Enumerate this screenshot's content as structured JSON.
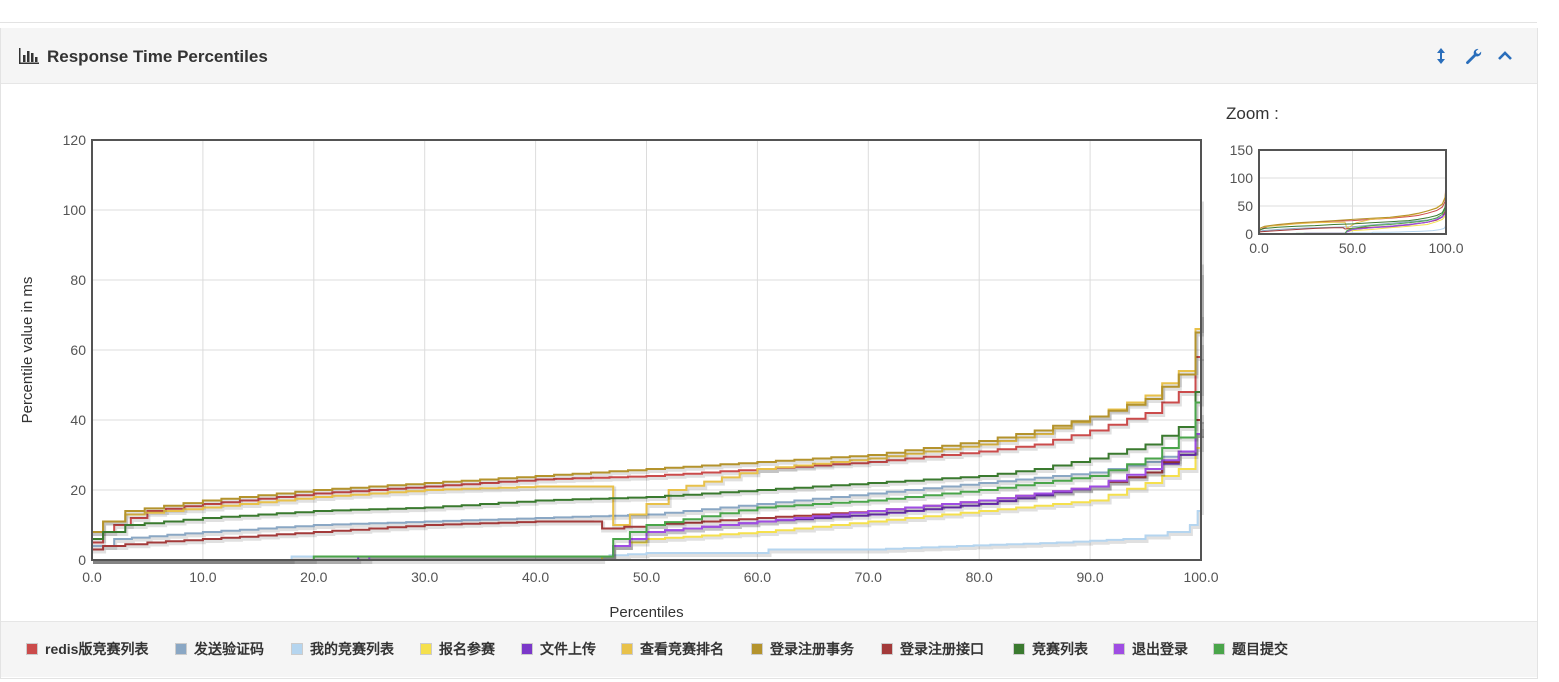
{
  "panel": {
    "title": "Response Time Percentiles",
    "icons": [
      "bar-chart-icon",
      "expand-vertical-icon",
      "wrench-icon",
      "chevron-up-icon"
    ]
  },
  "zoom": {
    "label": "Zoom :"
  },
  "chart_data": [
    {
      "type": "line",
      "title": "",
      "xlabel": "Percentiles",
      "ylabel": "Percentile value in ms",
      "xlim": [
        0,
        100
      ],
      "ylim": [
        0,
        120
      ],
      "xticks": [
        "0.0",
        "10.0",
        "20.0",
        "30.0",
        "40.0",
        "50.0",
        "60.0",
        "70.0",
        "80.0",
        "90.0",
        "100.0"
      ],
      "yticks": [
        "0",
        "20",
        "40",
        "60",
        "80",
        "100",
        "120"
      ],
      "grid": true,
      "legend_position": "bottom",
      "series": [
        {
          "name": "redis版竞赛列表",
          "color": "#cb4b4b",
          "points": [
            [
              0,
              5
            ],
            [
              1,
              8
            ],
            [
              2,
              10
            ],
            [
              5,
              14
            ],
            [
              10,
              16
            ],
            [
              20,
              19
            ],
            [
              30,
              21
            ],
            [
              40,
              23
            ],
            [
              50,
              24
            ],
            [
              60,
              26
            ],
            [
              70,
              28
            ],
            [
              80,
              31
            ],
            [
              85,
              33
            ],
            [
              90,
              37
            ],
            [
              95,
              42
            ],
            [
              98,
              48
            ],
            [
              99.5,
              58
            ],
            [
              100,
              103
            ]
          ]
        },
        {
          "name": "发送验证码",
          "color": "#8aa7c4",
          "points": [
            [
              0,
              4
            ],
            [
              2,
              6
            ],
            [
              10,
              8
            ],
            [
              20,
              10
            ],
            [
              30,
              11
            ],
            [
              40,
              12
            ],
            [
              50,
              13
            ],
            [
              60,
              16
            ],
            [
              70,
              19
            ],
            [
              80,
              22
            ],
            [
              90,
              25
            ],
            [
              95,
              28
            ],
            [
              98,
              31
            ],
            [
              99.5,
              36
            ],
            [
              100,
              40
            ]
          ]
        },
        {
          "name": "我的竞赛列表",
          "color": "#b5d5ef",
          "points": [
            [
              0,
              0
            ],
            [
              17,
              0
            ],
            [
              18,
              1
            ],
            [
              45,
              1
            ],
            [
              50,
              2
            ],
            [
              60,
              2
            ],
            [
              61,
              3
            ],
            [
              70,
              3
            ],
            [
              78,
              4
            ],
            [
              87,
              5
            ],
            [
              93,
              6
            ],
            [
              97,
              8
            ],
            [
              99,
              10
            ],
            [
              99.7,
              14
            ],
            [
              100,
              36
            ]
          ]
        },
        {
          "name": "报名参赛",
          "color": "#f5e04d",
          "points": [
            [
              0,
              0
            ],
            [
              45,
              0
            ],
            [
              46,
              1
            ],
            [
              47,
              4
            ],
            [
              50,
              6
            ],
            [
              60,
              8
            ],
            [
              70,
              11
            ],
            [
              80,
              14
            ],
            [
              90,
              17
            ],
            [
              95,
              22
            ],
            [
              98,
              26
            ],
            [
              99.5,
              32
            ],
            [
              100,
              38
            ]
          ]
        },
        {
          "name": "文件上传",
          "color": "#7b38c9",
          "points": [
            [
              0,
              0
            ],
            [
              23,
              0
            ],
            [
              24,
              1
            ],
            [
              46,
              1
            ],
            [
              47,
              4
            ],
            [
              50,
              8
            ],
            [
              60,
              11
            ],
            [
              70,
              13
            ],
            [
              80,
              16
            ],
            [
              90,
              21
            ],
            [
              95,
              25
            ],
            [
              98,
              30
            ],
            [
              99.5,
              36
            ],
            [
              100,
              40
            ]
          ]
        },
        {
          "name": "查看竞赛排名",
          "color": "#e8c14a",
          "points": [
            [
              0,
              8
            ],
            [
              1,
              11
            ],
            [
              3,
              13
            ],
            [
              10,
              15
            ],
            [
              20,
              18
            ],
            [
              30,
              20
            ],
            [
              40,
              21
            ],
            [
              46,
              21
            ],
            [
              47,
              10
            ],
            [
              50,
              16
            ],
            [
              52,
              20
            ],
            [
              60,
              26
            ],
            [
              70,
              29
            ],
            [
              80,
              33
            ],
            [
              85,
              36
            ],
            [
              90,
              41
            ],
            [
              95,
              47
            ],
            [
              98,
              54
            ],
            [
              99.5,
              66
            ],
            [
              100,
              82
            ]
          ]
        },
        {
          "name": "登录注册事务",
          "color": "#b4932c",
          "points": [
            [
              0,
              8
            ],
            [
              1,
              11
            ],
            [
              3,
              14
            ],
            [
              10,
              17
            ],
            [
              20,
              20
            ],
            [
              30,
              22
            ],
            [
              40,
              24
            ],
            [
              50,
              26
            ],
            [
              60,
              28
            ],
            [
              70,
              30
            ],
            [
              80,
              34
            ],
            [
              85,
              37
            ],
            [
              90,
              41
            ],
            [
              95,
              46
            ],
            [
              98,
              53
            ],
            [
              99.5,
              65
            ],
            [
              100,
              85
            ]
          ]
        },
        {
          "name": "登录注册接口",
          "color": "#a33a3a",
          "points": [
            [
              0,
              3
            ],
            [
              1,
              4
            ],
            [
              5,
              5
            ],
            [
              10,
              6
            ],
            [
              20,
              8
            ],
            [
              30,
              10
            ],
            [
              40,
              11
            ],
            [
              45,
              11
            ],
            [
              46,
              9
            ],
            [
              50,
              10
            ],
            [
              60,
              12
            ],
            [
              70,
              14
            ],
            [
              80,
              17
            ],
            [
              85,
              19
            ],
            [
              90,
              21
            ],
            [
              95,
              25
            ],
            [
              98,
              31
            ],
            [
              99.5,
              40
            ],
            [
              100,
              58
            ]
          ]
        },
        {
          "name": "竞赛列表",
          "color": "#3a7a2f",
          "points": [
            [
              0,
              6
            ],
            [
              1,
              8
            ],
            [
              3,
              10
            ],
            [
              10,
              12
            ],
            [
              20,
              14
            ],
            [
              30,
              15
            ],
            [
              40,
              17
            ],
            [
              50,
              18
            ],
            [
              60,
              20
            ],
            [
              70,
              22
            ],
            [
              80,
              24
            ],
            [
              85,
              26
            ],
            [
              90,
              29
            ],
            [
              95,
              33
            ],
            [
              98,
              38
            ],
            [
              99.5,
              48
            ],
            [
              100,
              70
            ]
          ]
        },
        {
          "name": "退出登录",
          "color": "#9f4de3",
          "points": [
            [
              0,
              0
            ],
            [
              24,
              0
            ],
            [
              25,
              1
            ],
            [
              46,
              1
            ],
            [
              47,
              4
            ],
            [
              50,
              8
            ],
            [
              60,
              11
            ],
            [
              70,
              14
            ],
            [
              80,
              17
            ],
            [
              90,
              21
            ],
            [
              95,
              26
            ],
            [
              98,
              31
            ],
            [
              99.5,
              36
            ],
            [
              100,
              42
            ]
          ]
        },
        {
          "name": "题目提交",
          "color": "#4aa54a",
          "points": [
            [
              0,
              0
            ],
            [
              18,
              0
            ],
            [
              20,
              1
            ],
            [
              46,
              1
            ],
            [
              47,
              6
            ],
            [
              50,
              10
            ],
            [
              60,
              15
            ],
            [
              70,
              17
            ],
            [
              80,
              20
            ],
            [
              85,
              22
            ],
            [
              90,
              24
            ],
            [
              95,
              29
            ],
            [
              98,
              35
            ],
            [
              99.5,
              45
            ],
            [
              100,
              62
            ]
          ]
        }
      ]
    },
    {
      "type": "line",
      "title": "Zoom :",
      "xlim": [
        0,
        100
      ],
      "ylim": [
        0,
        150
      ],
      "xticks": [
        "0.0",
        "50.0",
        "100.0"
      ],
      "yticks": [
        "0",
        "50",
        "100",
        "150"
      ],
      "grid": true,
      "series_ref": "same as main chart"
    }
  ]
}
